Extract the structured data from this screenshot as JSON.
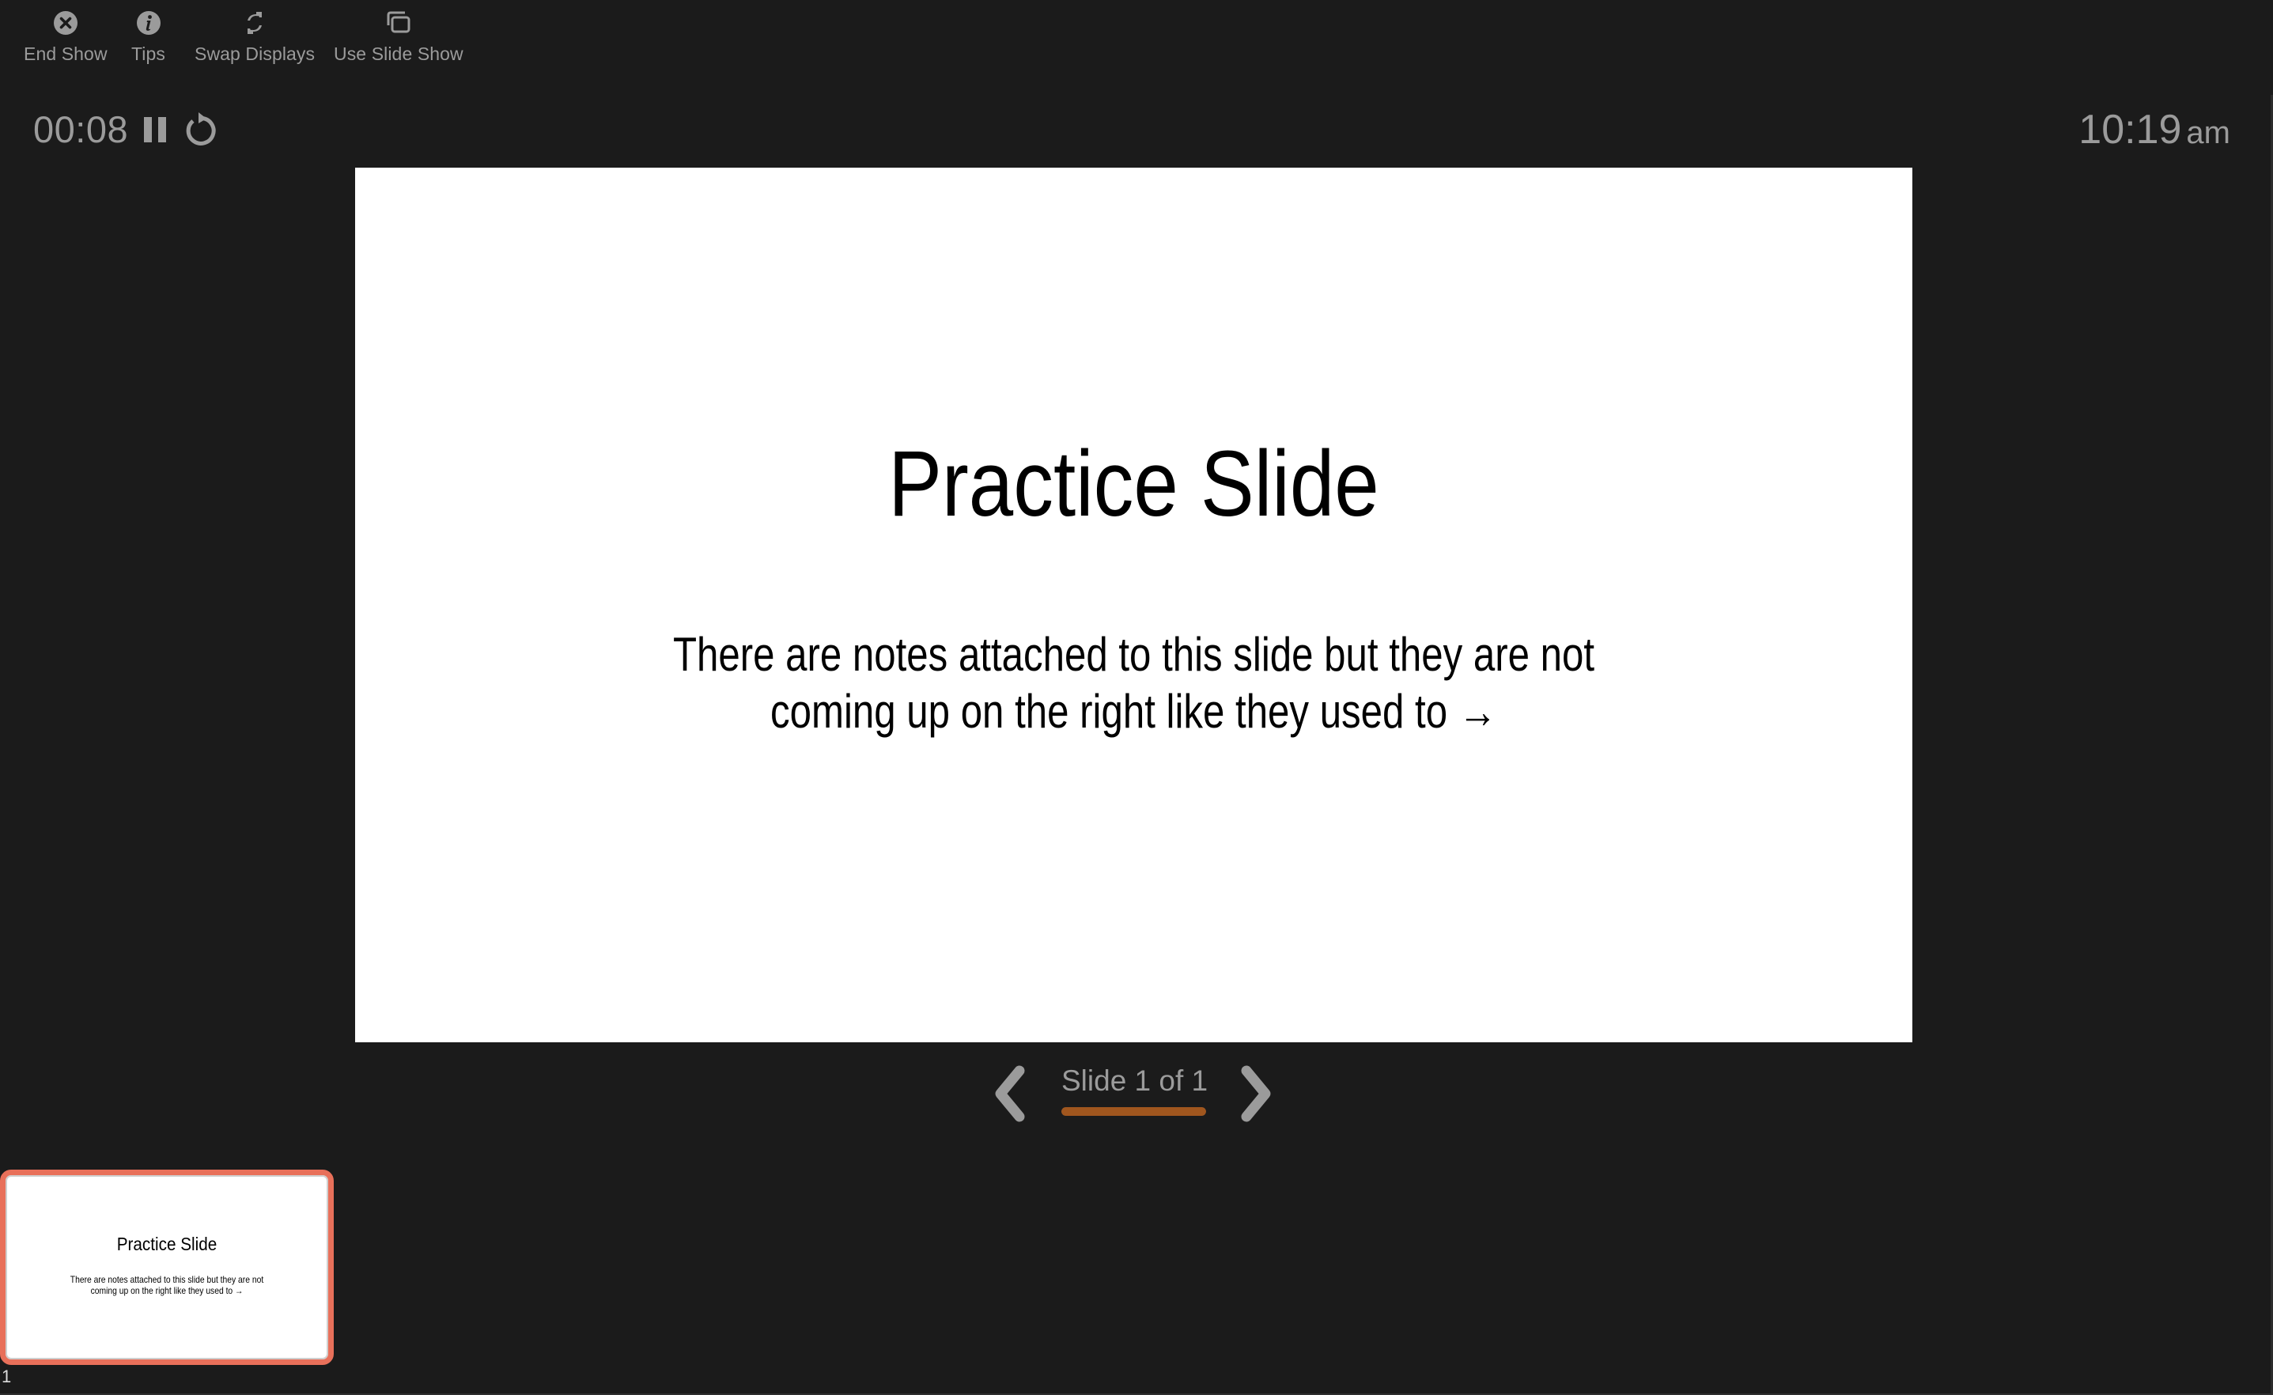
{
  "toolbar": {
    "items": [
      {
        "id": "end-show",
        "label": "End Show",
        "icon": "close-circle-icon"
      },
      {
        "id": "tips",
        "label": "Tips",
        "icon": "info-icon"
      },
      {
        "id": "swap-displays",
        "label": "Swap Displays",
        "icon": "swap-icon"
      },
      {
        "id": "use-slide-show",
        "label": "Use Slide Show",
        "icon": "windows-icon"
      }
    ]
  },
  "timer": {
    "elapsed": "00:08",
    "pause_icon": "pause-icon",
    "reset_icon": "reset-icon"
  },
  "clock": {
    "time": "10:19",
    "period": "am"
  },
  "slide": {
    "title": "Practice Slide",
    "body_line1": "There are notes attached to this slide but they are not",
    "body_line2": "coming up on the right like they used to →"
  },
  "navigation": {
    "counter": "Slide 1 of 1",
    "current": 1,
    "total": 1,
    "progress_fraction": 1.0,
    "progress_color": "#a0561e",
    "prev_icon": "chevron-left-icon",
    "next_icon": "chevron-right-icon"
  },
  "thumbnails": [
    {
      "number": "1",
      "title": "Practice Slide",
      "body_line1": "There are notes attached to this slide but they are not",
      "body_line2": "coming up on the right like they used to →",
      "selected": true,
      "selected_border_color": "#e8705a"
    }
  ]
}
